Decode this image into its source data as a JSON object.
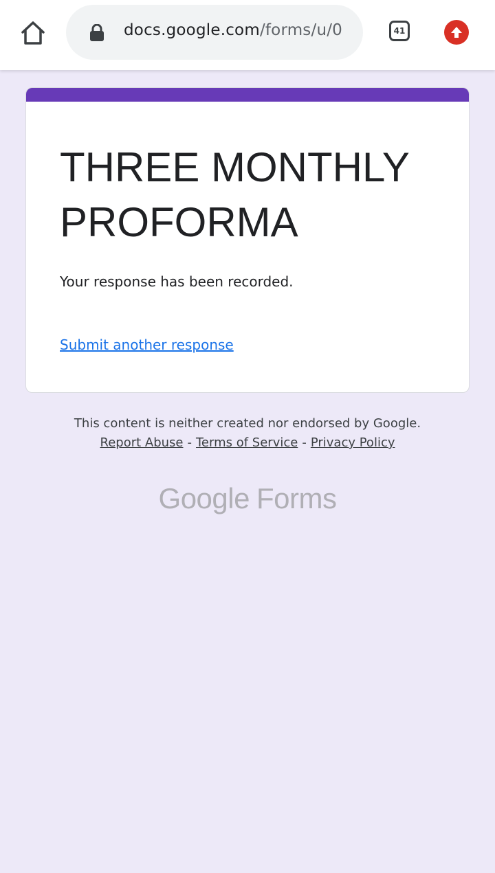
{
  "browser": {
    "url_host": "docs.google.com",
    "url_path": "/forms/u/0",
    "tab_count": "41",
    "icons": {
      "home": "home-icon",
      "lock": "lock-icon",
      "update": "update-arrow-icon"
    },
    "colors": {
      "update_badge": "#d93025"
    }
  },
  "form": {
    "title": "THREE MONTHLY PROFORMA",
    "confirmation": "Your response has been recorded.",
    "submit_another": "Submit another response",
    "accent_color": "#673ab7"
  },
  "footer": {
    "disclaimer": "This content is neither created nor endorsed by Google.",
    "report_abuse": "Report Abuse",
    "terms": "Terms of Service",
    "privacy": "Privacy Policy",
    "separator": "-",
    "logo_google": "Google",
    "logo_forms": "Forms"
  },
  "page": {
    "background": "#ede9f8"
  }
}
